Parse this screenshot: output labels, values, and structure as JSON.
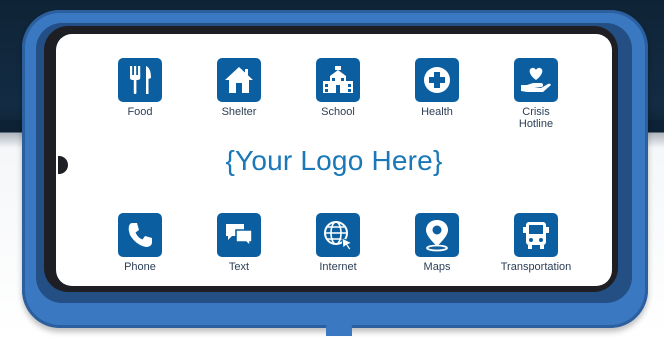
{
  "logo_text": "{Your Logo Here}",
  "apps_top": [
    {
      "label": "Food",
      "icon": "fork-knife-icon"
    },
    {
      "label": "Shelter",
      "icon": "house-icon"
    },
    {
      "label": "School",
      "icon": "school-building-icon"
    },
    {
      "label": "Health",
      "icon": "medical-cross-icon"
    },
    {
      "label": "Crisis Hotline",
      "icon": "heart-hand-icon"
    }
  ],
  "apps_bottom": [
    {
      "label": "Phone",
      "icon": "phone-icon"
    },
    {
      "label": "Text",
      "icon": "chat-bubbles-icon"
    },
    {
      "label": "Internet",
      "icon": "globe-icon"
    },
    {
      "label": "Maps",
      "icon": "map-pin-icon"
    },
    {
      "label": "Transportation",
      "icon": "bus-icon"
    }
  ],
  "colors": {
    "icon_bg": "#0b5fa0",
    "logo": "#1a78b8",
    "case": "#3a79c2"
  }
}
